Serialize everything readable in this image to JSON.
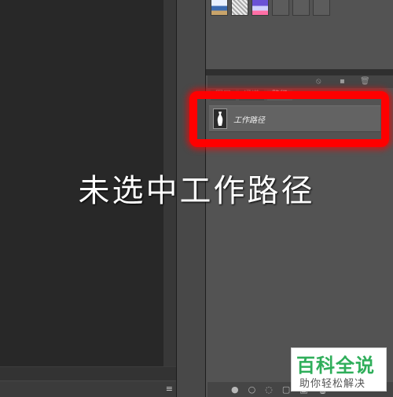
{
  "status_bar": {
    "menu_glyph": "≡"
  },
  "paths_panel": {
    "tabs": [
      {
        "label": "图层"
      },
      {
        "label": "通道"
      },
      {
        "label": "路径"
      }
    ],
    "active_tab": "路径",
    "items": [
      {
        "name": "工作路径"
      }
    ],
    "top_icons": [
      "⦸",
      "▪",
      "🗑"
    ],
    "bottom_icons": [
      "●",
      "○",
      "◌",
      "▢",
      "▣",
      "🗑"
    ]
  },
  "caption": "未选中工作路径",
  "watermark": {
    "main": "百科全说",
    "sub": "助你轻松解决"
  },
  "colors": {
    "highlight": "#ff0000",
    "watermark_green": "#2fae5a"
  }
}
